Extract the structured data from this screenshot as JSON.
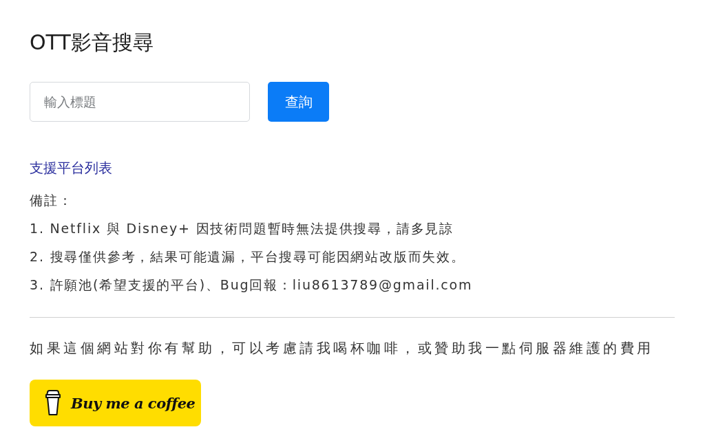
{
  "title": "OTT影音搜尋",
  "search": {
    "placeholder": "輸入標題",
    "button": "查詢"
  },
  "platform_link": "支援平台列表",
  "notes": {
    "heading": "備註：",
    "items": [
      "1. Netflix 與 Disney+ 因技術問題暫時無法提供搜尋，請多見諒",
      "2. 搜尋僅供參考，結果可能遺漏，平台搜尋可能因網站改版而失效。",
      "3. 許願池(希望支援的平台)、Bug回報：liu8613789@gmail.com"
    ]
  },
  "support": {
    "text": "如果這個網站對你有幫助，可以考慮請我喝杯咖啡，或贊助我一點伺服器維護的費用",
    "button": "Buy me a coffee"
  }
}
